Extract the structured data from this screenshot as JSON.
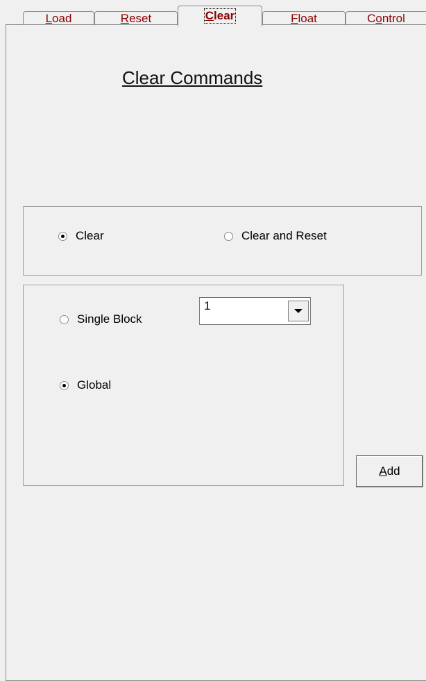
{
  "tabs": [
    {
      "mnemonic": "L",
      "rest": "oad",
      "active": false
    },
    {
      "mnemonic": "R",
      "rest": "eset",
      "active": false
    },
    {
      "mnemonic": "C",
      "rest": "lear",
      "active": true
    },
    {
      "mnemonic": "F",
      "rest": "loat",
      "active": false
    },
    {
      "mnemonic": "",
      "prefix": "C",
      "mnemonic_mid": "o",
      "rest": "ntrol",
      "active": false
    }
  ],
  "tab_labels": {
    "load_m": "L",
    "load_r": "oad",
    "reset_m": "R",
    "reset_r": "eset",
    "clear_m": "C",
    "clear_r": "lear",
    "float_m": "F",
    "float_r": "loat",
    "control_p": "C",
    "control_m": "o",
    "control_r": "ntrol"
  },
  "page_title": "Clear Commands",
  "mode_group": {
    "options": [
      {
        "label": "Clear",
        "selected": true
      },
      {
        "label": "Clear and Reset",
        "selected": false
      }
    ]
  },
  "scope_group": {
    "options": [
      {
        "label": "Single Block",
        "selected": false
      },
      {
        "label": "Global",
        "selected": true
      }
    ],
    "block_select": {
      "value": "1"
    }
  },
  "add_button": {
    "mnemonic": "A",
    "rest": "dd"
  },
  "colors": {
    "background": "#f0f0f0",
    "tab_text_accent": "#8b0000"
  }
}
